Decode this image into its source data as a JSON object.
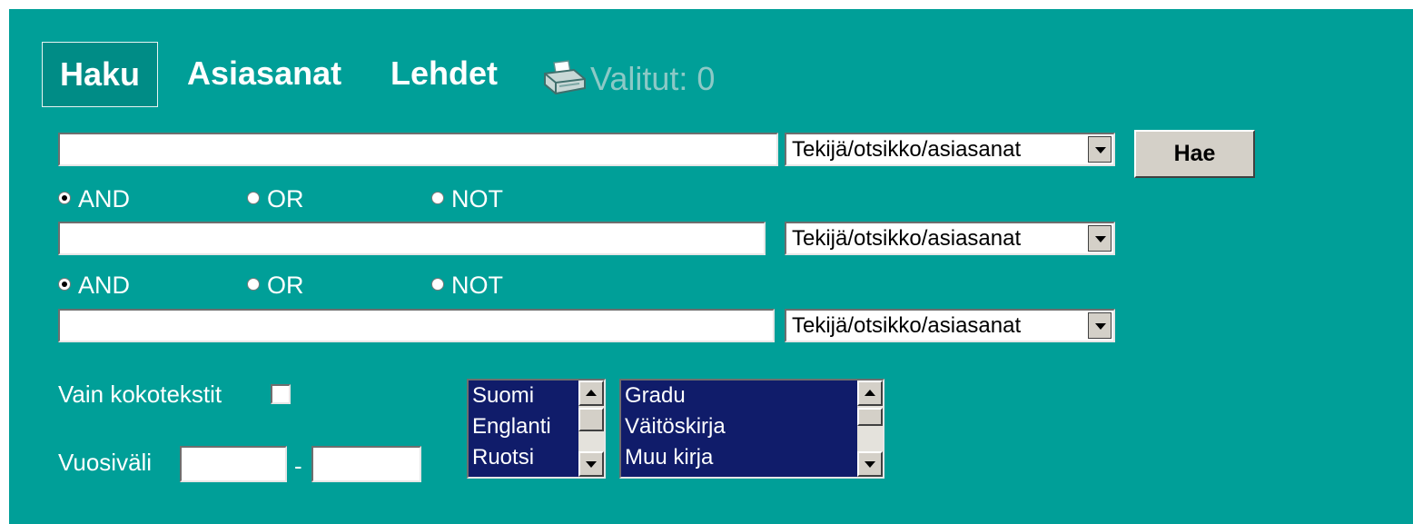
{
  "tabs": {
    "haku": "Haku",
    "asiasanat": "Asiasanat",
    "lehdet": "Lehdet",
    "valitut": "Valitut: 0",
    "valitut_icon": "printer-icon"
  },
  "search": {
    "row1": {
      "value": "",
      "field": "Tekijä/otsikko/asiasanat"
    },
    "op1": {
      "selected": "AND",
      "options": [
        "AND",
        "OR",
        "NOT"
      ]
    },
    "row2": {
      "value": "",
      "field": "Tekijä/otsikko/asiasanat"
    },
    "op2": {
      "selected": "AND",
      "options": [
        "AND",
        "OR",
        "NOT"
      ]
    },
    "row3": {
      "value": "",
      "field": "Tekijä/otsikko/asiasanat"
    },
    "submit_label": "Hae"
  },
  "filters": {
    "fulltext_label": "Vain kokotekstit",
    "fulltext_checked": false,
    "year_label": "Vuosiväli",
    "year_separator": "-",
    "year_from": "",
    "year_to": "",
    "languages": [
      "Suomi",
      "Englanti",
      "Ruotsi"
    ],
    "types": [
      "Gradu",
      "Väitöskirja",
      "Muu kirja"
    ]
  },
  "colors": {
    "panel_background": "#009f98",
    "active_tab": "#008c86",
    "listbox_background": "#101c6a",
    "button_face": "#d4d0c8"
  }
}
